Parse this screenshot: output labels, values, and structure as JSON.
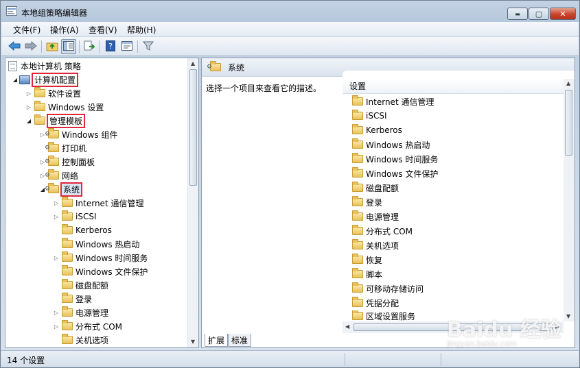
{
  "window": {
    "title": "本地组策略编辑器",
    "controls": {
      "minimize": "▬",
      "maximize": "▢",
      "close": "✕"
    }
  },
  "menubar": [
    {
      "label": "文件(F)"
    },
    {
      "label": "操作(A)"
    },
    {
      "label": "查看(V)"
    },
    {
      "label": "帮助(H)"
    }
  ],
  "toolbar": {
    "icons": [
      "back-icon",
      "forward-icon",
      "up-folder-icon",
      "show-hide-tree-icon",
      "export-list-icon",
      "help-icon",
      "properties-icon",
      "filter-icon"
    ]
  },
  "tree": {
    "root": "本地计算机 策略",
    "computer_config": "计算机配置",
    "software_settings": "软件设置",
    "windows_settings": "Windows 设置",
    "admin_templates": "管理模板",
    "windows_components": "Windows 组件",
    "printers": "打印机",
    "control_panel": "控制面板",
    "network": "网络",
    "system": "系统",
    "children": [
      "Internet 通信管理",
      "iSCSI",
      "Kerberos",
      "Windows 热启动",
      "Windows 时间服务",
      "Windows 文件保护",
      "磁盘配额",
      "登录",
      "电源管理",
      "分布式 COM",
      "关机选项"
    ]
  },
  "right_pane": {
    "header_title": "系统",
    "description": "选择一个项目来查看它的描述。",
    "column_header": "设置",
    "items": [
      "Internet 通信管理",
      "iSCSI",
      "Kerberos",
      "Windows 热启动",
      "Windows 时间服务",
      "Windows 文件保护",
      "磁盘配额",
      "登录",
      "电源管理",
      "分布式 COM",
      "关机选项",
      "恢复",
      "脚本",
      "可移动存储访问",
      "凭据分配",
      "区域设置服务"
    ],
    "tabs": [
      "扩展",
      "标准"
    ]
  },
  "statusbar": {
    "text": "14 个设置"
  },
  "watermark": {
    "main": "Baidu 经验",
    "sub": "jingyan.baidu.com"
  }
}
